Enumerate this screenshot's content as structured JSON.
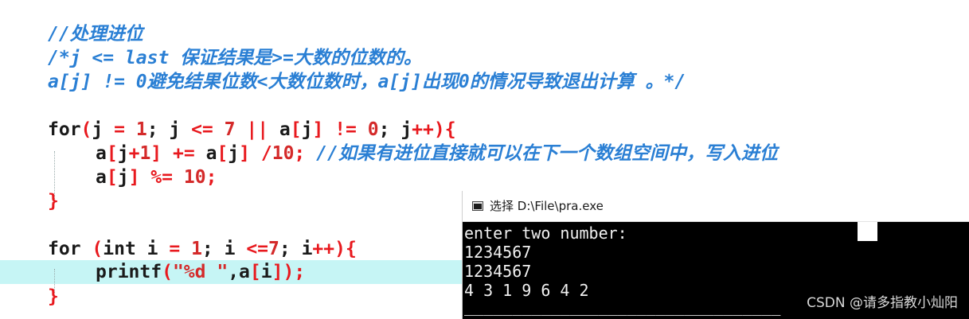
{
  "editor": {
    "comments": [
      "//处理进位",
      "/*j <= last 保证结果是>=大数的位数的。",
      "a[j] != 0避免结果位数<大数位数时，a[j]出现0的情况导致退出计算 。*/"
    ],
    "loop1": {
      "kw_for": "for",
      "p_open": "(",
      "j1": "j ",
      "eq": "=",
      "sp1": " ",
      "one": "1",
      "semi1": "; j ",
      "le": "<=",
      "sp2": " ",
      "seven": "7",
      "sp3": " ",
      "or": "||",
      "aj": " a",
      "b1": "[",
      "j2": "j",
      "b2": "]",
      "sp4": " ",
      "ne": "!=",
      "sp5": " ",
      "zero": "0",
      "semi2": "; j",
      "inc": "++",
      "p_close": "){"
    },
    "body1": {
      "a1": "a",
      "br1": "[",
      "j1": "j",
      "plus": "+",
      "one": "1",
      "br2": "]",
      "sp1": " ",
      "pe": "+=",
      "a2": " a",
      "br3": "[",
      "j2": "j",
      "br4": "]",
      "sp2": " ",
      "div": "/",
      "ten": "10",
      "semi": ";",
      "comment": " //如果有进位直接就可以在下一个数组空间中，写入进位"
    },
    "body2": {
      "a1": "a",
      "br1": "[",
      "j1": "j",
      "br2": "]",
      "sp1": " ",
      "mod": "%=",
      "sp2": " ",
      "ten": "10",
      "semi": ";"
    },
    "close1": "}",
    "loop2": {
      "kw_for": "for",
      "p_open": " (",
      "kw_int": "int",
      "i1": " i ",
      "eq": "=",
      "sp1": " ",
      "one": "1",
      "semi1": "; i ",
      "le": "<=",
      "seven": "7",
      "semi2": "; i",
      "inc": "++",
      "p_close": "){"
    },
    "body3": {
      "fn": "printf",
      "p_open": "(",
      "str": "\"%d \"",
      "comma": ",a",
      "br1": "[",
      "i": "i",
      "br2": "]",
      "p_close": ");"
    },
    "close2": "}"
  },
  "console": {
    "title": "选择 D:\\File\\pra.exe",
    "lines": [
      "enter two number:",
      "1234567",
      "1234567",
      "4 3 1 9 6 4 2",
      "_________________________________"
    ]
  },
  "watermark": "CSDN @请多指教小灿阳",
  "colors": {
    "comment": "#2a7fd4",
    "keyword": "#1a1a1a",
    "operator": "#e8191e",
    "number": "#d42a2a",
    "highlight": "#c6f5f5"
  }
}
